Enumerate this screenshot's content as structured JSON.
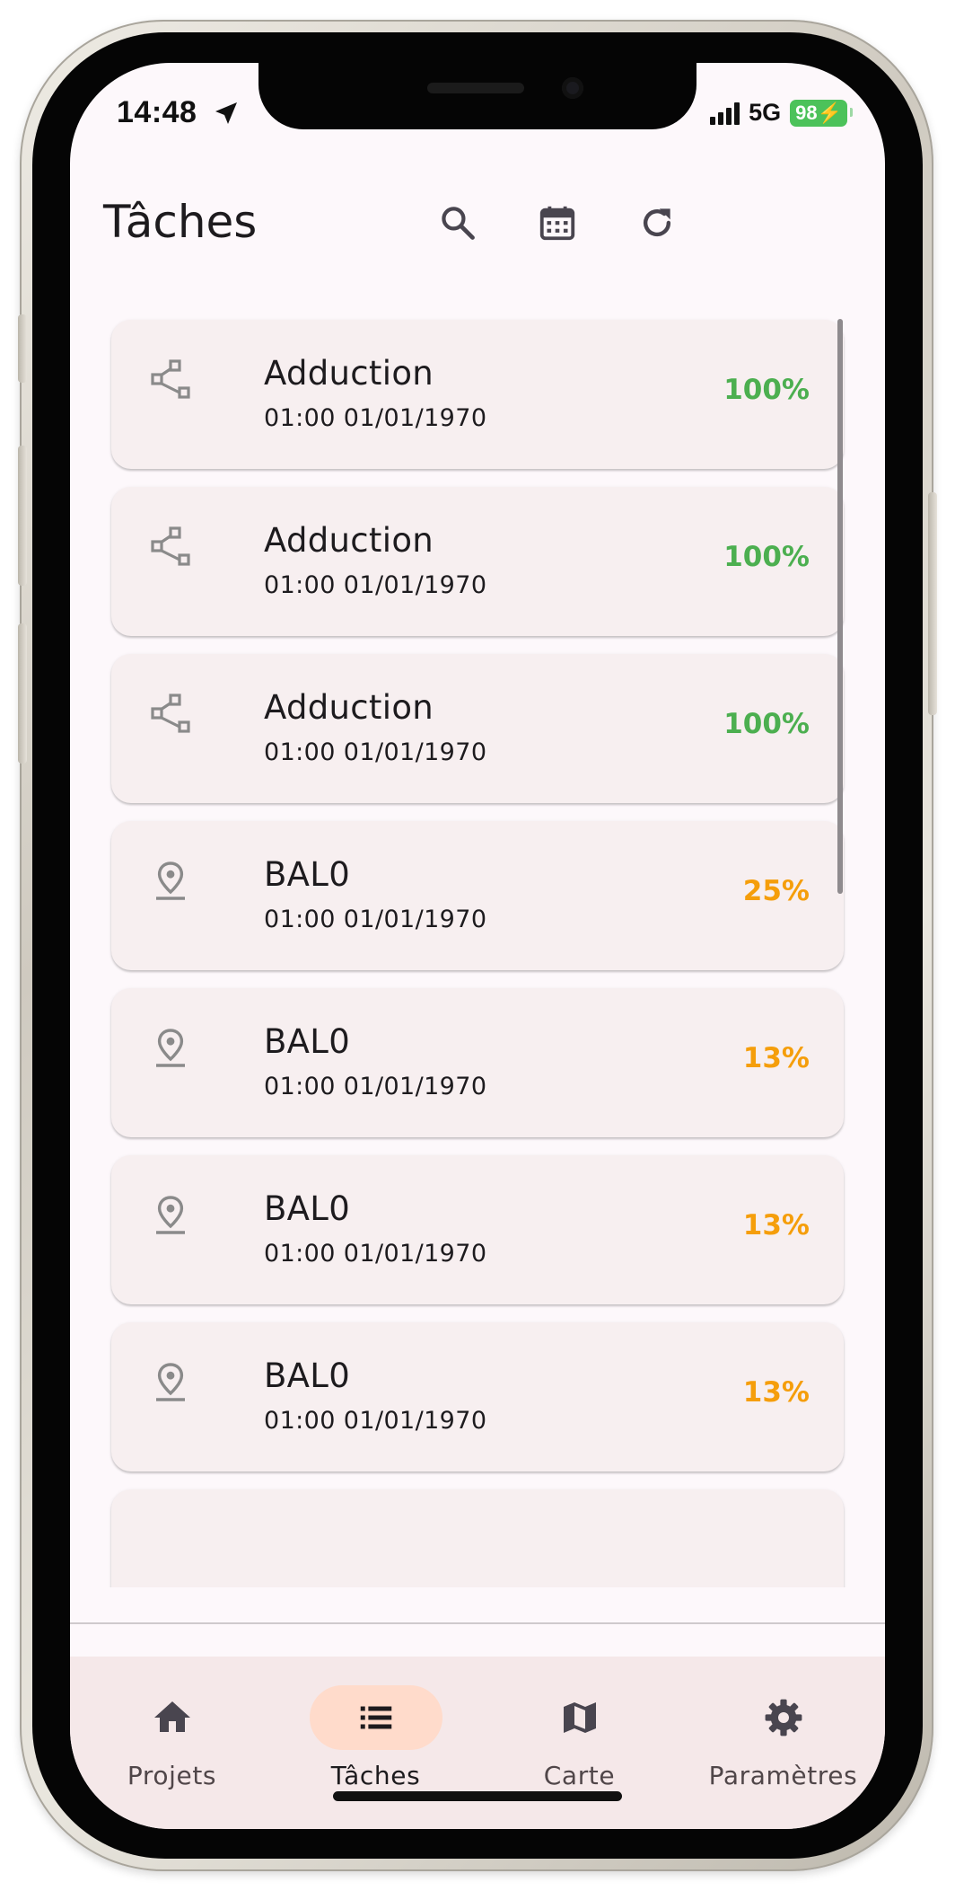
{
  "status_bar": {
    "time": "14:48",
    "network": "5G",
    "battery": "98"
  },
  "header": {
    "title": "Tâches"
  },
  "toolbar": {
    "icons": [
      "search-icon",
      "calendar-icon",
      "refresh-icon"
    ]
  },
  "tasks": [
    {
      "name": "Adduction",
      "datetime": "01:00 01/01/1970",
      "progress": "100%",
      "icon": "network-icon",
      "status_color": "#4caf50"
    },
    {
      "name": "Adduction",
      "datetime": "01:00 01/01/1970",
      "progress": "100%",
      "icon": "network-icon",
      "status_color": "#4caf50"
    },
    {
      "name": "Adduction",
      "datetime": "01:00 01/01/1970",
      "progress": "100%",
      "icon": "network-icon",
      "status_color": "#4caf50"
    },
    {
      "name": "BAL0",
      "datetime": "01:00 01/01/1970",
      "progress": "25%",
      "icon": "location-pin-icon",
      "status_color": "#f59e0b"
    },
    {
      "name": "BAL0",
      "datetime": "01:00 01/01/1970",
      "progress": "13%",
      "icon": "location-pin-icon",
      "status_color": "#f59e0b"
    },
    {
      "name": "BAL0",
      "datetime": "01:00 01/01/1970",
      "progress": "13%",
      "icon": "location-pin-icon",
      "status_color": "#f59e0b"
    },
    {
      "name": "BAL0",
      "datetime": "01:00 01/01/1970",
      "progress": "13%",
      "icon": "location-pin-icon",
      "status_color": "#f59e0b"
    }
  ],
  "bottom_nav": {
    "items": [
      {
        "label": "Projets",
        "icon": "home-icon",
        "active": false
      },
      {
        "label": "Tâches",
        "icon": "list-icon",
        "active": true
      },
      {
        "label": "Carte",
        "icon": "map-icon",
        "active": false
      },
      {
        "label": "Paramètres",
        "icon": "gear-icon",
        "active": false
      }
    ]
  },
  "colors": {
    "background": "#fdf8fb",
    "card": "#f7eff0",
    "nav_background": "#f5e8e9",
    "nav_active": "#ffdbcb",
    "complete": "#4caf50",
    "partial": "#f59e0b"
  }
}
